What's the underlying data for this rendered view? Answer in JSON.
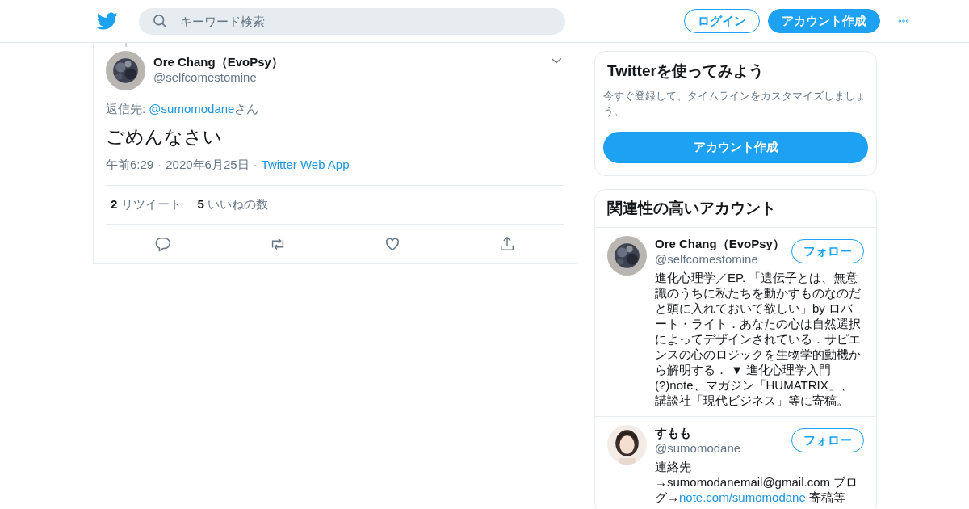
{
  "header": {
    "search": {
      "placeholder": "キーワード検索"
    },
    "buttons": [
      {
        "label": "ログイン",
        "kind": "outline"
      },
      {
        "label": "アカウント作成",
        "kind": "filled"
      }
    ]
  },
  "tweet": {
    "author": {
      "name": "Ore Chang（EvoPsy）",
      "handle": "@selfcomestomine"
    },
    "reply_to": [
      {
        "text": "返信先: ",
        "kind": "plain"
      },
      {
        "text": "@sumomodane",
        "kind": "link"
      },
      {
        "text": "さん",
        "kind": "plain"
      }
    ],
    "text": "ごめんなさい",
    "meta": [
      {
        "text": "午前6:29",
        "kind": "plain"
      },
      {
        "text": "·",
        "kind": "separator"
      },
      {
        "text": "2020年6月25日",
        "kind": "plain"
      },
      {
        "text": "·",
        "kind": "separator"
      },
      {
        "text": "Twitter Web App",
        "kind": "link"
      }
    ],
    "stats": [
      {
        "count": "2",
        "label": "リツイート"
      },
      {
        "count": "5",
        "label": "いいねの数"
      }
    ],
    "actions": [
      {
        "kind": "reply"
      },
      {
        "kind": "retweet"
      },
      {
        "kind": "like"
      },
      {
        "kind": "share"
      }
    ]
  },
  "signup_card": {
    "title": "Twitterを使ってみよう",
    "text": "今すぐ登録して、タイムラインをカスタマイズしましょう。",
    "button": "アカウント作成"
  },
  "related": {
    "title": "関連性の高いアカウント",
    "accounts": [
      {
        "name": "Ore Chang（EvoPsy）",
        "handle": "@selfcomestomine",
        "follow": "フォロー",
        "bio": [
          {
            "text": "進化心理学／EP. 「遺伝子とは、無意識のうちに私たちを動かすものなのだと頭に入れておいて欲しい」by ロバート・ライト．あなたの心は自然選択によってデザインされている．サピエンスの心のロジックを生物学的動機から解明する． ▼ 進化心理学入門(?)note、マガジン「HUMATRIX」、講談社「現代ビジネス」等に寄稿。",
            "kind": "plain"
          }
        ]
      },
      {
        "name": "すもも",
        "handle": "@sumomodane",
        "follow": "フォロー",
        "bio": [
          {
            "text": "連絡先 →sumomodanemail@gmail.com ブログ→",
            "kind": "plain"
          },
          {
            "text": "note.com/sumomodane",
            "kind": "link"
          },
          {
            "text": " 寄稿等",
            "kind": "plain"
          }
        ]
      }
    ]
  }
}
